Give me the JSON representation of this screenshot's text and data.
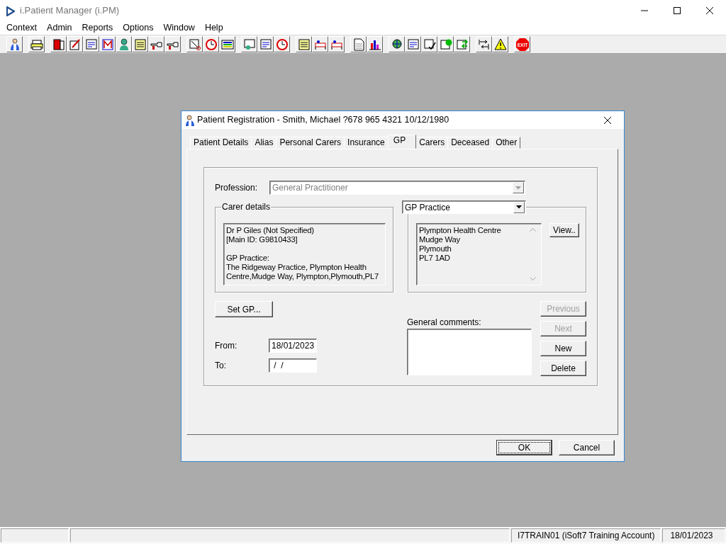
{
  "app": {
    "title": "i.Patient Manager (i.PM)"
  },
  "menu": [
    "Context",
    "Admin",
    "Reports",
    "Options",
    "Window",
    "Help"
  ],
  "toolbar": {
    "exit_label": "EXIT"
  },
  "dialog": {
    "title": "Patient Registration - Smith, Michael ?678 965 4321 10/12/1980",
    "tabs": [
      {
        "label": "Patient Details",
        "selected": false
      },
      {
        "label": "Alias",
        "selected": false
      },
      {
        "label": "Personal Carers",
        "selected": false
      },
      {
        "label": "Insurance",
        "selected": false
      },
      {
        "label": "GP",
        "selected": true
      },
      {
        "label": "Carers",
        "selected": false
      },
      {
        "label": "Deceased",
        "selected": false
      },
      {
        "label": "Other",
        "selected": false
      }
    ],
    "profession": {
      "label": "Profession:",
      "value": "General Practitioner",
      "disabled": true
    },
    "carer_details": {
      "label": "Carer details",
      "paragraphs": [
        [
          "Dr P Giles (Not Specified)",
          "[Main ID: G9810433]"
        ],
        [
          "GP Practice:",
          "The Ridgeway Practice, Plympton Health Centre,Mudge Way, Plympton,Plymouth,PL7"
        ]
      ]
    },
    "practice": {
      "selector": "GP Practice",
      "address": [
        "Plympton Health Centre",
        "Mudge Way",
        "Plymouth",
        "PL7 1AD"
      ],
      "view_button": "View.."
    },
    "set_gp_button": "Set GP...",
    "from": {
      "label": "From:",
      "value": "18/01/2023"
    },
    "to": {
      "label": "To:",
      "value": " /  /"
    },
    "comments": {
      "label": "General comments:"
    },
    "side_buttons": [
      {
        "label": "Previous",
        "disabled": true
      },
      {
        "label": "Next",
        "disabled": true
      },
      {
        "label": "New",
        "disabled": false
      },
      {
        "label": "Delete",
        "disabled": false
      }
    ],
    "footer_buttons": [
      {
        "label": "OK",
        "focused": true
      },
      {
        "label": "Cancel",
        "focused": false
      }
    ]
  },
  "status_bar": {
    "user": "I7TRAIN01 (iSoft7 Training Account)",
    "date": "18/01/2023"
  }
}
